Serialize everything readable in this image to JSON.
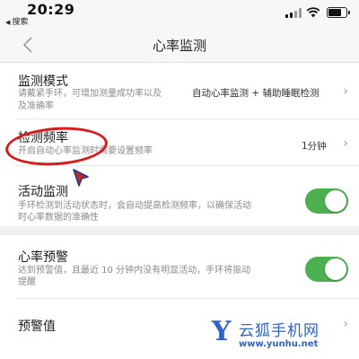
{
  "status_bar": {
    "time": "20:29",
    "back_app": "搜索",
    "battery_level": 0.8
  },
  "nav": {
    "title": "心率监测",
    "back_icon": "chevron-left-icon"
  },
  "settings": {
    "monitor_mode": {
      "title": "监测模式",
      "desc_line1": "请戴紧手环，可增加测量成功率以及",
      "desc_line2": "及准确率",
      "value": "自动心率监测 + 辅助睡眠检测"
    },
    "frequency": {
      "title": "检测频率",
      "desc": "开启自动心率监测时需要设置频率",
      "value": "1分钟"
    },
    "activity": {
      "title": "活动监测",
      "desc_line1": "手环检测到活动状态时，会自动提高检测频率，以确保活动",
      "desc_line2": "时心率数据的准确性",
      "enabled": true
    },
    "alert": {
      "title": "心率预警",
      "desc_line1": "达到预警值，且最近 10 分钟内没有明显活动，手环将振动",
      "desc_line2": "提醒",
      "enabled": true
    },
    "threshold": {
      "title": "预警值"
    }
  },
  "watermark": {
    "logo": "Y",
    "name": "云狐手机网",
    "url": "www.yunhu.net"
  },
  "colors": {
    "toggle_on": "#4caf50",
    "annotation": "#d81b1b",
    "watermark": "#2e64c8"
  }
}
